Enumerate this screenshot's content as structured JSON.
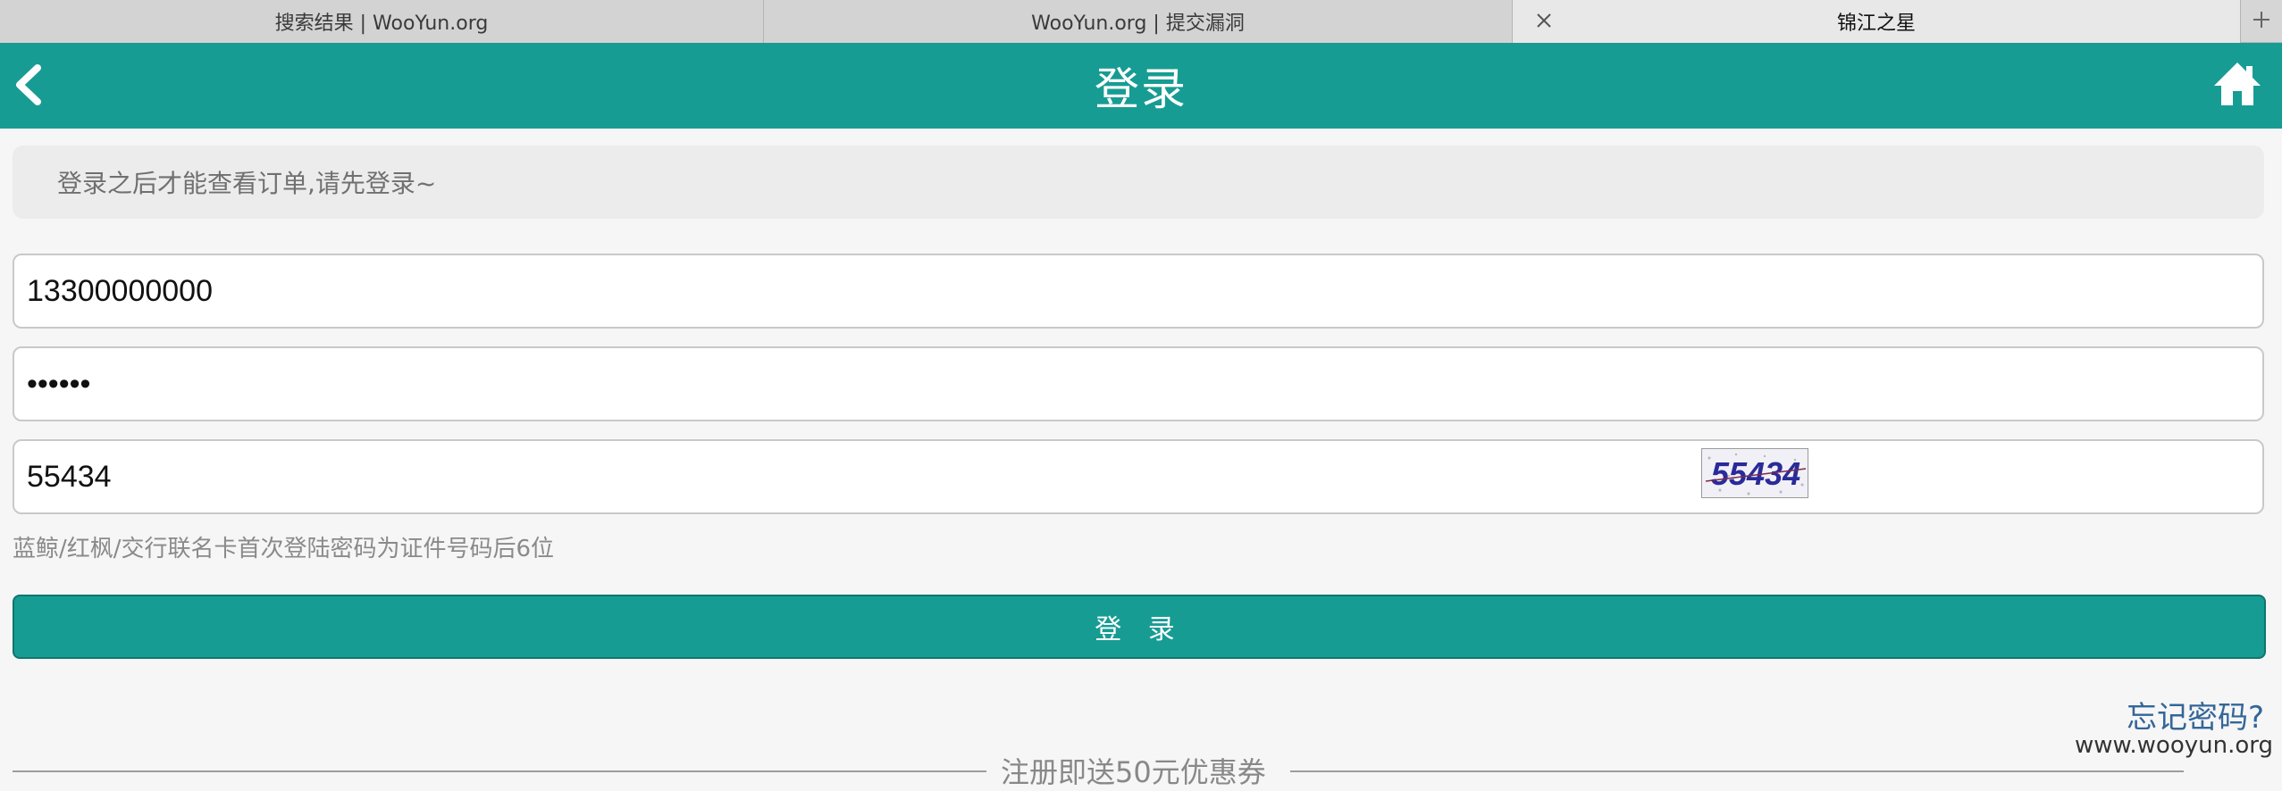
{
  "browser": {
    "tabs": [
      {
        "title": "搜索结果 | WooYun.org"
      },
      {
        "title": "WooYun.org | 提交漏洞"
      },
      {
        "title": "锦江之星"
      }
    ]
  },
  "header": {
    "title": "登录"
  },
  "notice": "登录之后才能查看订单,请先登录~",
  "form": {
    "phone": "13300000000",
    "password": "••••••",
    "captcha_value": "55434",
    "captcha_image_text": "55434",
    "hint": "蓝鲸/红枫/交行联名卡首次登陆密码为证件号码后6位",
    "login_label": "登 录",
    "forgot_label": "忘记密码?"
  },
  "promo": "注册即送50元优惠券",
  "watermark": "www.wooyun.org",
  "colors": {
    "brand": "#179c93",
    "link": "#336699",
    "captcha_text": "#2a2a9a"
  }
}
